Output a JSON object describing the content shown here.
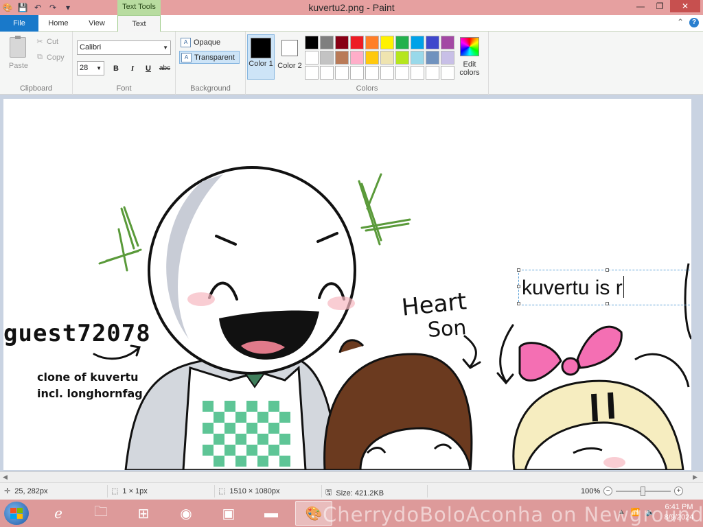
{
  "window": {
    "title": "kuvertu2.png - Paint",
    "contextual_tab": "Text Tools",
    "controls": {
      "minimize": "—",
      "maximize": "❐",
      "close": "✕"
    }
  },
  "menu_tabs": {
    "file": "File",
    "home": "Home",
    "view": "View",
    "text": "Text"
  },
  "ribbon": {
    "clipboard": {
      "paste": "Paste",
      "cut": "Cut",
      "copy": "Copy",
      "title": "Clipboard"
    },
    "font": {
      "family": "Calibri",
      "size": "28",
      "bold": "B",
      "italic": "I",
      "underline": "U",
      "strike": "abc",
      "title": "Font"
    },
    "background": {
      "opaque": "Opaque",
      "transparent": "Transparent",
      "title": "Background"
    },
    "colors": {
      "color1_label": "Color 1",
      "color2_label": "Color 2",
      "color1": "#000000",
      "color2": "#ffffff",
      "edit_label": "Edit colors",
      "title": "Colors",
      "palette": [
        "#000000",
        "#7f7f7f",
        "#880015",
        "#ed1c24",
        "#ff7f27",
        "#fff200",
        "#22b14c",
        "#00a2e8",
        "#3f48cc",
        "#a349a4",
        "#ffffff",
        "#c3c3c3",
        "#b97a57",
        "#ffaec9",
        "#ffc90e",
        "#efe4b0",
        "#b5e61d",
        "#99d9ea",
        "#7092be",
        "#c8bfe7",
        "#ffffff",
        "#ffffff",
        "#ffffff",
        "#ffffff",
        "#ffffff",
        "#ffffff",
        "#ffffff",
        "#ffffff",
        "#ffffff",
        "#ffffff"
      ]
    }
  },
  "canvas": {
    "text_box": "kuvertu is r",
    "labels": {
      "guest": "guest72078",
      "clone_line1": "clone of kuvertu",
      "clone_line2": "incl. longhornfag",
      "heart": "Heart",
      "son": "Son"
    }
  },
  "status": {
    "cursor": "25, 282px",
    "selection": "1 × 1px",
    "image_size": "1510 × 1080px",
    "file_size": "Size: 421.2KB",
    "zoom": "100%"
  },
  "taskbar": {
    "time": "6:41 PM",
    "date": "8/9/2024",
    "watermark": "CherrydoBoloAconha on Newgrounds"
  }
}
